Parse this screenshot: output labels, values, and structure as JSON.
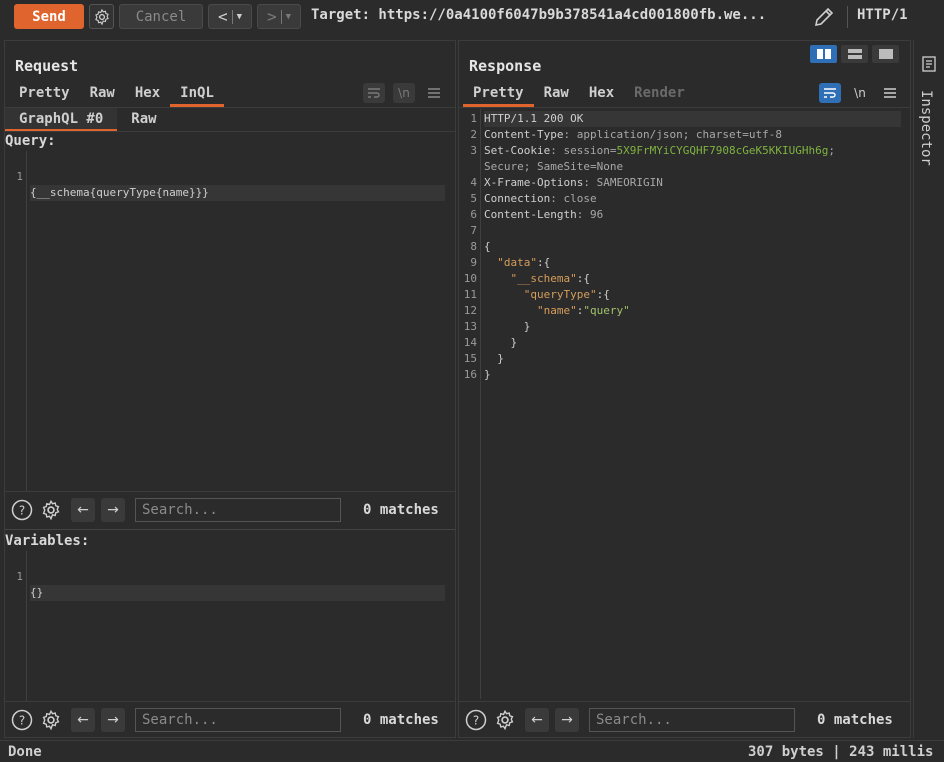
{
  "toolbar": {
    "send_label": "Send",
    "cancel_label": "Cancel",
    "prev_label": "<",
    "next_label": ">",
    "target_text": "Target: https://0a4100f6047b9b378541a4cd001800fb.we...",
    "http_version": "HTTP/1",
    "icons": [
      "gear-icon",
      "pencil-icon"
    ]
  },
  "request": {
    "title": "Request",
    "tabs": [
      "Pretty",
      "Raw",
      "Hex",
      "InQL"
    ],
    "active_tab": "InQL",
    "subtabs": [
      "GraphQL #0",
      "Raw"
    ],
    "query_label": "Query:",
    "query_lines": [
      {
        "n": "1",
        "text": "{__schema{queryType{name}}}"
      }
    ],
    "variables_label": "Variables:",
    "variables_lines": [
      {
        "n": "1",
        "text": "{}"
      }
    ],
    "search_placeholder": "Search...",
    "matches_text": "0 matches"
  },
  "response": {
    "title": "Response",
    "tabs": [
      "Pretty",
      "Raw",
      "Hex",
      "Render"
    ],
    "active_tab": "Pretty",
    "lines": [
      {
        "n": "1",
        "parts": [
          [
            "k",
            "HTTP/1.1 "
          ],
          [
            "k",
            "200 OK"
          ]
        ]
      },
      {
        "n": "2",
        "parts": [
          [
            "k",
            "Content-Type"
          ],
          [
            "v",
            ": application/json; charset=utf-8"
          ]
        ]
      },
      {
        "n": "3",
        "parts": [
          [
            "k",
            "Set-Cookie"
          ],
          [
            "v",
            ": session="
          ],
          [
            "g",
            "5X9FrMYiCYGQHF7908cGeK5KKIUGHh6g"
          ],
          [
            "v",
            ";"
          ]
        ]
      },
      {
        "n": "",
        "parts": [
          [
            "v",
            "Secure; SameSite=None"
          ]
        ]
      },
      {
        "n": "4",
        "parts": [
          [
            "k",
            "X-Frame-Options"
          ],
          [
            "v",
            ": SAMEORIGIN"
          ]
        ]
      },
      {
        "n": "5",
        "parts": [
          [
            "k",
            "Connection"
          ],
          [
            "v",
            ": close"
          ]
        ]
      },
      {
        "n": "6",
        "parts": [
          [
            "k",
            "Content-Length"
          ],
          [
            "v",
            ": 96"
          ]
        ]
      },
      {
        "n": "7",
        "parts": []
      },
      {
        "n": "8",
        "parts": [
          [
            "k",
            "{"
          ]
        ]
      },
      {
        "n": "9",
        "parts": [
          [
            "k",
            "  "
          ],
          [
            "p",
            "\"data\""
          ],
          [
            "k",
            ":{"
          ]
        ]
      },
      {
        "n": "10",
        "parts": [
          [
            "k",
            "    "
          ],
          [
            "p",
            "\"__schema\""
          ],
          [
            "k",
            ":{"
          ]
        ]
      },
      {
        "n": "11",
        "parts": [
          [
            "k",
            "      "
          ],
          [
            "p",
            "\"queryType\""
          ],
          [
            "k",
            ":{"
          ]
        ]
      },
      {
        "n": "12",
        "parts": [
          [
            "k",
            "        "
          ],
          [
            "p",
            "\"name\""
          ],
          [
            "k",
            ":"
          ],
          [
            "s",
            "\"query\""
          ]
        ]
      },
      {
        "n": "13",
        "parts": [
          [
            "k",
            "      }"
          ]
        ]
      },
      {
        "n": "14",
        "parts": [
          [
            "k",
            "    }"
          ]
        ]
      },
      {
        "n": "15",
        "parts": [
          [
            "k",
            "  }"
          ]
        ]
      },
      {
        "n": "16",
        "parts": [
          [
            "k",
            "}"
          ]
        ]
      }
    ],
    "search_placeholder": "Search...",
    "matches_text": "0 matches"
  },
  "inspector": {
    "label": "Inspector"
  },
  "status": {
    "left": "Done",
    "right": "307 bytes | 243 millis"
  },
  "colors": {
    "accent": "#e0642e",
    "active_blue": "#2f6fb5"
  }
}
